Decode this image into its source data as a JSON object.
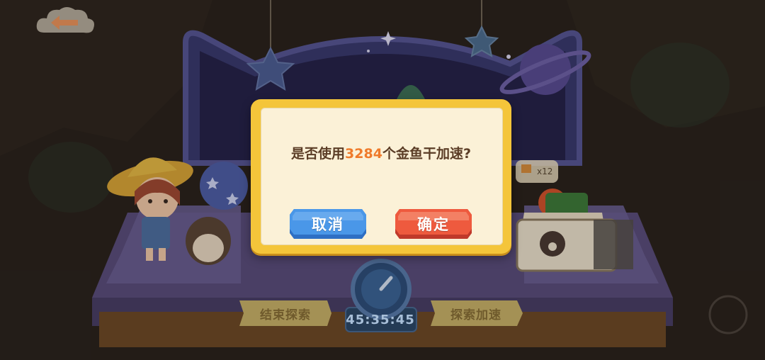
{
  "back_button": {
    "icon": "arrow-left-icon"
  },
  "dialog": {
    "message_prefix": "是否使用",
    "amount": "3284",
    "message_suffix": "个金鱼干加速?",
    "cancel_label": "取消",
    "confirm_label": "确定"
  },
  "bottom_bar": {
    "end_explore_label": "结束探索",
    "speed_up_label": "探索加速",
    "timer": "45:35:45"
  },
  "reward_badge": "x12",
  "colors": {
    "accent_orange": "#ef7a2a",
    "cancel_blue": "#3f8be0",
    "confirm_red": "#e54a36",
    "dialog_gold": "#f4c53a"
  }
}
